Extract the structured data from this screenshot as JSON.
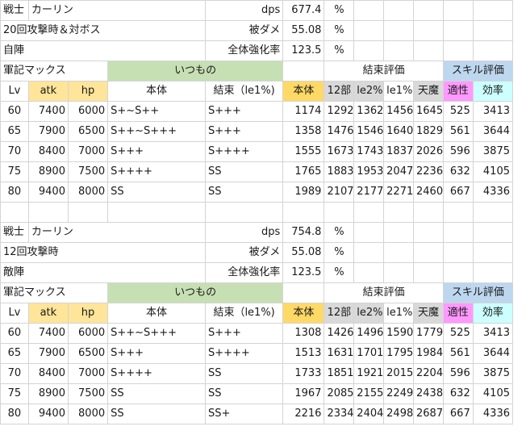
{
  "tables": [
    {
      "meta": [
        {
          "c0": "戦士",
          "c1": "カーリン",
          "label": "dps",
          "value": "677.4",
          "unit": "%"
        },
        {
          "c0": "20回攻撃時＆対ボス",
          "c1": "",
          "label": "被ダメ",
          "value": "55.08",
          "unit": "%"
        },
        {
          "c0": "自陣",
          "c1": "",
          "label": "全体強化率",
          "value": "123.5",
          "unit": "%"
        }
      ],
      "group_header": {
        "title": "軍記マックス",
        "itsumono": "いつもの",
        "kessoku": "結束評価",
        "skill": "スキル評価"
      },
      "col_header": {
        "lv": "Lv",
        "atk": "atk",
        "hp": "hp",
        "hontai": "本体",
        "kessoku": "結束（le1%)",
        "hontai2": "本体",
        "b12": "12部",
        "le2": "le2%",
        "le1": "le1%",
        "tenma": "天魔",
        "tekisei": "適性",
        "kouritsu": "効率"
      },
      "rows": [
        {
          "lv": "60",
          "atk": "7400",
          "hp": "6000",
          "hontai": "S+~S++",
          "kessoku": "S+++",
          "hontai2": "1174",
          "b12": "1292",
          "le2": "1362",
          "le1": "1456",
          "tenma": "1645",
          "tekisei": "525",
          "kouritsu": "3413"
        },
        {
          "lv": "65",
          "atk": "7900",
          "hp": "6500",
          "hontai": "S++~S+++",
          "kessoku": "S+++",
          "hontai2": "1358",
          "b12": "1476",
          "le2": "1546",
          "le1": "1640",
          "tenma": "1829",
          "tekisei": "561",
          "kouritsu": "3644"
        },
        {
          "lv": "70",
          "atk": "8400",
          "hp": "7000",
          "hontai": "S+++",
          "kessoku": "S++++",
          "hontai2": "1555",
          "b12": "1673",
          "le2": "1743",
          "le1": "1837",
          "tenma": "2026",
          "tekisei": "596",
          "kouritsu": "3875"
        },
        {
          "lv": "75",
          "atk": "8900",
          "hp": "7500",
          "hontai": "S++++",
          "kessoku": "SS",
          "hontai2": "1765",
          "b12": "1883",
          "le2": "1953",
          "le1": "2047",
          "tenma": "2236",
          "tekisei": "632",
          "kouritsu": "4105"
        },
        {
          "lv": "80",
          "atk": "9400",
          "hp": "8000",
          "hontai": "SS",
          "kessoku": "SS",
          "hontai2": "1989",
          "b12": "2107",
          "le2": "2177",
          "le1": "2271",
          "tenma": "2460",
          "tekisei": "667",
          "kouritsu": "4336"
        }
      ]
    },
    {
      "meta": [
        {
          "c0": "戦士",
          "c1": "カーリン",
          "label": "dps",
          "value": "754.8",
          "unit": "%"
        },
        {
          "c0": "12回攻撃時",
          "c1": "",
          "label": "被ダメ",
          "value": "55.08",
          "unit": "%"
        },
        {
          "c0": "敵陣",
          "c1": "",
          "label": "全体強化率",
          "value": "123.5",
          "unit": "%"
        }
      ],
      "group_header": {
        "title": "軍記マックス",
        "itsumono": "いつもの",
        "kessoku": "結束評価",
        "skill": "スキル評価"
      },
      "col_header": {
        "lv": "Lv",
        "atk": "atk",
        "hp": "hp",
        "hontai": "本体",
        "kessoku": "結束（le1%)",
        "hontai2": "本体",
        "b12": "12部",
        "le2": "le2%",
        "le1": "le1%",
        "tenma": "天魔",
        "tekisei": "適性",
        "kouritsu": "効率"
      },
      "rows": [
        {
          "lv": "60",
          "atk": "7400",
          "hp": "6000",
          "hontai": "S++~S+++",
          "kessoku": "S+++",
          "hontai2": "1308",
          "b12": "1426",
          "le2": "1496",
          "le1": "1590",
          "tenma": "1779",
          "tekisei": "525",
          "kouritsu": "3413"
        },
        {
          "lv": "65",
          "atk": "7900",
          "hp": "6500",
          "hontai": "S+++",
          "kessoku": "S++++",
          "hontai2": "1513",
          "b12": "1631",
          "le2": "1701",
          "le1": "1795",
          "tenma": "1984",
          "tekisei": "561",
          "kouritsu": "3644"
        },
        {
          "lv": "70",
          "atk": "8400",
          "hp": "7000",
          "hontai": "S++++",
          "kessoku": "SS",
          "hontai2": "1733",
          "b12": "1851",
          "le2": "1921",
          "le1": "2015",
          "tenma": "2204",
          "tekisei": "596",
          "kouritsu": "3875"
        },
        {
          "lv": "75",
          "atk": "8900",
          "hp": "7500",
          "hontai": "SS",
          "kessoku": "SS",
          "hontai2": "1967",
          "b12": "2085",
          "le2": "2155",
          "le1": "2249",
          "tenma": "2438",
          "tekisei": "632",
          "kouritsu": "4105"
        },
        {
          "lv": "80",
          "atk": "9400",
          "hp": "8000",
          "hontai": "SS",
          "kessoku": "SS+",
          "hontai2": "2216",
          "b12": "2334",
          "le2": "2404",
          "le1": "2498",
          "tenma": "2687",
          "tekisei": "667",
          "kouritsu": "4336"
        }
      ]
    }
  ]
}
